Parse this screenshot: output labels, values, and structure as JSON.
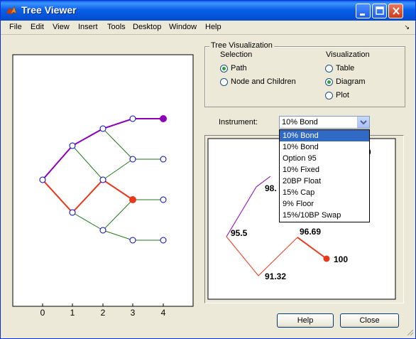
{
  "window": {
    "title": "Tree Viewer"
  },
  "menu": [
    "File",
    "Edit",
    "View",
    "Insert",
    "Tools",
    "Desktop",
    "Window",
    "Help"
  ],
  "left_plot": {
    "x_ticks": [
      "0",
      "1",
      "2",
      "3",
      "4"
    ]
  },
  "tree_viz": {
    "title": "Tree Visualization",
    "selection_label": "Selection",
    "selection_options": [
      "Path",
      "Node and Children"
    ],
    "selection_selected": "Path",
    "visualization_label": "Visualization",
    "visualization_options": [
      "Table",
      "Diagram",
      "Plot"
    ],
    "visualization_selected": "Diagram"
  },
  "instrument": {
    "label": "Instrument:",
    "value": "10% Bond",
    "options": [
      "10% Bond",
      "10% Bond",
      "Option 95",
      "10% Fixed",
      "20BP Float",
      "15% Cap",
      "9% Floor",
      "15%/10BP Swap"
    ]
  },
  "diagram_labels": {
    "root": "95.5",
    "upper": "98.",
    "down": "91.32",
    "mid": "96.69",
    "end": "100",
    "top_partial": "0"
  },
  "buttons": {
    "help": "Help",
    "close": "Close"
  },
  "colors": {
    "title_bar": "#0a5fe8",
    "selected_path": "#8b00b8",
    "highlight_path": "#e8381a",
    "tree_lines": "#1f7a1f",
    "nodes": "#0000cc"
  }
}
